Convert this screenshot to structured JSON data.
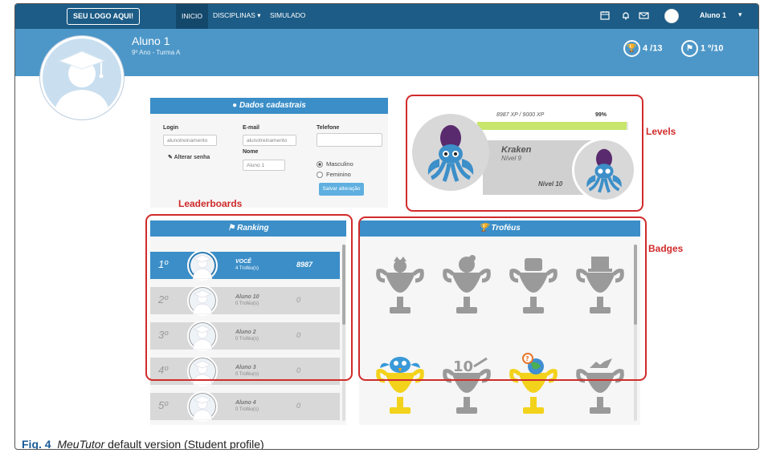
{
  "nav": {
    "logo": "SEU LOGO AQUI!",
    "items": [
      {
        "label": "INICIO",
        "active": true
      },
      {
        "label": "DISCIPLINAS ▾",
        "active": false
      },
      {
        "label": "SIMULADO",
        "active": false
      }
    ],
    "icons": [
      "calendar-icon",
      "bell-icon",
      "envelope-icon"
    ],
    "user": "Aluno 1",
    "caret": "▾"
  },
  "header": {
    "name": "Aluno 1",
    "class": "9º Ano - Turma A",
    "trophies_stat": "4 /13",
    "rank_stat": "1 º/10",
    "color": "#4d97c8"
  },
  "dados": {
    "title": "Dados cadastrais",
    "login_label": "Login",
    "login_value": "alunotreinamento",
    "email_label": "E-mail",
    "email_value": "alunotreinamento",
    "telefone_label": "Telefone",
    "telefone_value": "",
    "nome_label": "Nome",
    "nome_value": "Aluno 1",
    "alterar_senha": "Alterar senha",
    "gender_options": [
      "Masculino",
      "Feminino"
    ],
    "gender_selected": "Masculino",
    "save_label": "Salvar alteração"
  },
  "levels": {
    "xp_text": "8987 XP / 9000 XP",
    "percent_text": "99%",
    "progress": 0.99,
    "current_name": "Kraken",
    "current_level": "Nível 9",
    "next_level": "Nível 10"
  },
  "ranking": {
    "title": "Ranking",
    "rows": [
      {
        "pos": "1º",
        "name": "VOCÊ",
        "trophies": "4 Troféu(s)",
        "score": "8987",
        "me": true
      },
      {
        "pos": "2º",
        "name": "Aluno 10",
        "trophies": "0 Troféu(s)",
        "score": "0",
        "me": false
      },
      {
        "pos": "3º",
        "name": "Aluno 2",
        "trophies": "0 Troféu(s)",
        "score": "0",
        "me": false
      },
      {
        "pos": "4º",
        "name": "Aluno 3",
        "trophies": "0 Troféu(s)",
        "score": "0",
        "me": false
      },
      {
        "pos": "5º",
        "name": "Aluno 4",
        "trophies": "0 Troféu(s)",
        "score": "0",
        "me": false
      }
    ]
  },
  "trofeus": {
    "title": "Troféus",
    "first_row_locked": [
      "angel-trophy-icon",
      "ball-trophy-icon",
      "hat-trophy-icon",
      "top-hat-trophy-icon"
    ],
    "second_row": [
      {
        "icon": "bird-trophy-icon",
        "earned": true
      },
      {
        "icon": "ten-trophy-icon",
        "earned": false
      },
      {
        "icon": "globe-trophy-icon",
        "earned": true
      },
      {
        "icon": "bat-trophy-icon",
        "earned": false
      }
    ],
    "ten_text": "10",
    "question_text": "?"
  },
  "annotations": {
    "levels": "Levels",
    "leaderboards": "Leaderboards",
    "badges": "Badges",
    "color": "#d12b2b"
  },
  "caption": {
    "prefix": "Fig. 4",
    "italic": "MeuTutor",
    "rest": " default version (Student profile)"
  }
}
